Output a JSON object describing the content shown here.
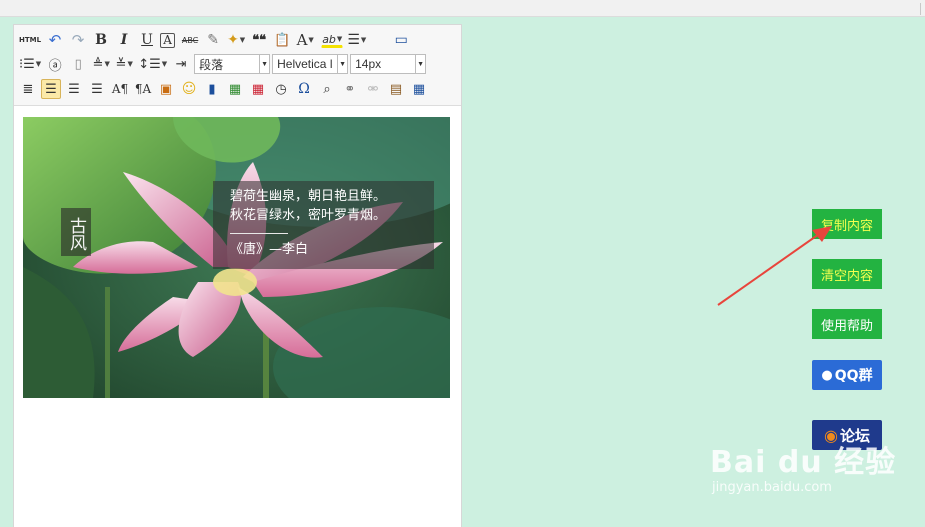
{
  "toolbar": {
    "row1": [
      {
        "name": "html-source-button",
        "label": "HTML"
      },
      {
        "name": "undo-icon",
        "label": "↶"
      },
      {
        "name": "redo-icon",
        "label": "↷"
      },
      {
        "name": "bold-button",
        "label": "B"
      },
      {
        "name": "italic-button",
        "label": "I"
      },
      {
        "name": "underline-button",
        "label": "U"
      },
      {
        "name": "font-border-button",
        "label": "A"
      },
      {
        "name": "strikethrough-button",
        "label": "ABC"
      },
      {
        "name": "eraser-icon",
        "label": "✎"
      },
      {
        "name": "magic-wand-icon",
        "label": "✦"
      },
      {
        "name": "blockquote-icon",
        "label": "❝❝"
      },
      {
        "name": "paste-plain-icon",
        "label": "📋"
      },
      {
        "name": "font-color-button",
        "label": "A"
      },
      {
        "name": "highlight-button",
        "label": "ab"
      },
      {
        "name": "ordered-list-icon",
        "label": "☰"
      },
      {
        "name": "fullscreen-icon",
        "label": "▭"
      }
    ],
    "paragraph_select": "段落",
    "font_family_select": "Helvetica l",
    "font_size_select": "14px"
  },
  "poem": {
    "vertical_title": "古风",
    "line1": "碧荷生幽泉，朝日艳且鲜。",
    "line2": "秋花冒绿水，密叶罗青烟。",
    "author": "《唐》—李白"
  },
  "sidebar": {
    "copy_label": "复制内容",
    "clear_label": "清空内容",
    "help_label": "使用帮助",
    "qq_label": "QQ群",
    "forum_label": "论坛"
  },
  "watermark": {
    "logo_text": "Bai du 经验",
    "url": "jingyan.baidu.com"
  },
  "colors": {
    "page_bg": "#cdf0e0",
    "button_green": "#23b341",
    "button_text_yellow": "#f4ff4f",
    "arrow_red": "#e8453c"
  }
}
